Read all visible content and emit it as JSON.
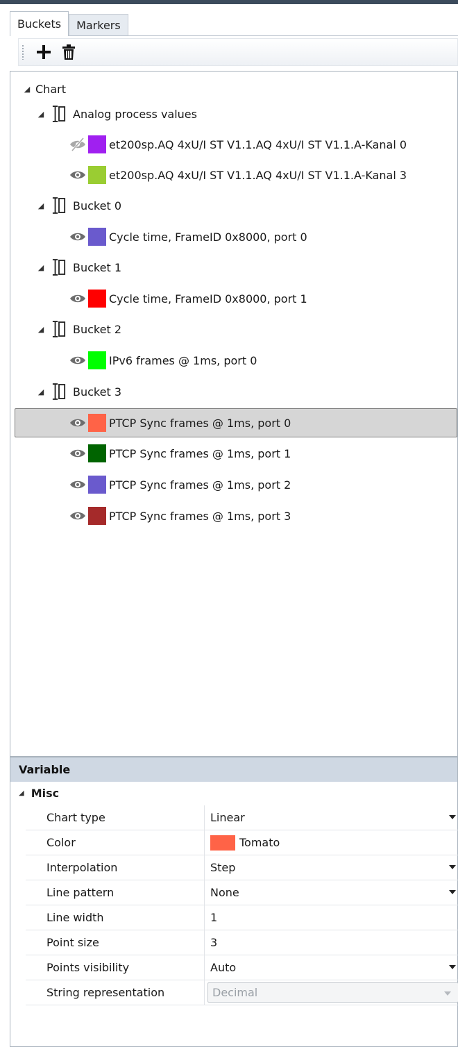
{
  "tabs": [
    {
      "label": "Buckets",
      "active": true
    },
    {
      "label": "Markers",
      "active": false
    }
  ],
  "toolbar": {
    "add_icon": "plus-icon",
    "delete_icon": "trash-icon"
  },
  "tree": {
    "root_label": "Chart",
    "groups": [
      {
        "label": "Analog process values",
        "variables": [
          {
            "label": "et200sp.AQ 4xU/I ST V1.1.AQ 4xU/I ST V1.1.A-Kanal 0",
            "color": "#a020f0",
            "visible": false
          },
          {
            "label": "et200sp.AQ 4xU/I ST V1.1.AQ 4xU/I ST V1.1.A-Kanal 3",
            "color": "#9acd32",
            "visible": true
          }
        ]
      },
      {
        "label": "Bucket 0",
        "variables": [
          {
            "label": "Cycle time, FrameID 0x8000, port 0",
            "color": "#6a5acd",
            "visible": true
          }
        ]
      },
      {
        "label": "Bucket 1",
        "variables": [
          {
            "label": "Cycle time, FrameID 0x8000, port 1",
            "color": "#ff0000",
            "visible": true
          }
        ]
      },
      {
        "label": "Bucket 2",
        "variables": [
          {
            "label": "IPv6 frames @ 1ms, port 0",
            "color": "#00ff00",
            "visible": true
          }
        ]
      },
      {
        "label": "Bucket 3",
        "variables": [
          {
            "label": "PTCP Sync frames @ 1ms, port 0",
            "color": "#ff6347",
            "visible": true,
            "selected": true
          },
          {
            "label": "PTCP Sync frames @ 1ms, port 1",
            "color": "#006400",
            "visible": true
          },
          {
            "label": "PTCP Sync frames @ 1ms, port 2",
            "color": "#6a5acd",
            "visible": true
          },
          {
            "label": "PTCP Sync frames @ 1ms, port 3",
            "color": "#a52a2a",
            "visible": true
          }
        ]
      }
    ]
  },
  "properties": {
    "title": "Variable",
    "category": "Misc",
    "rows": [
      {
        "name": "Chart type",
        "value": "Linear",
        "dropdown": true
      },
      {
        "name": "Color",
        "value": "Tomato",
        "swatch": "#ff6347"
      },
      {
        "name": "Interpolation",
        "value": "Step",
        "dropdown": true
      },
      {
        "name": "Line pattern",
        "value": "None",
        "dropdown": true
      },
      {
        "name": "Line width",
        "value": "1"
      },
      {
        "name": "Point size",
        "value": "3"
      },
      {
        "name": "Points visibility",
        "value": "Auto",
        "dropdown": true
      },
      {
        "name": "String representation",
        "value": "Decimal",
        "dropdown": true,
        "disabled": true
      }
    ]
  }
}
